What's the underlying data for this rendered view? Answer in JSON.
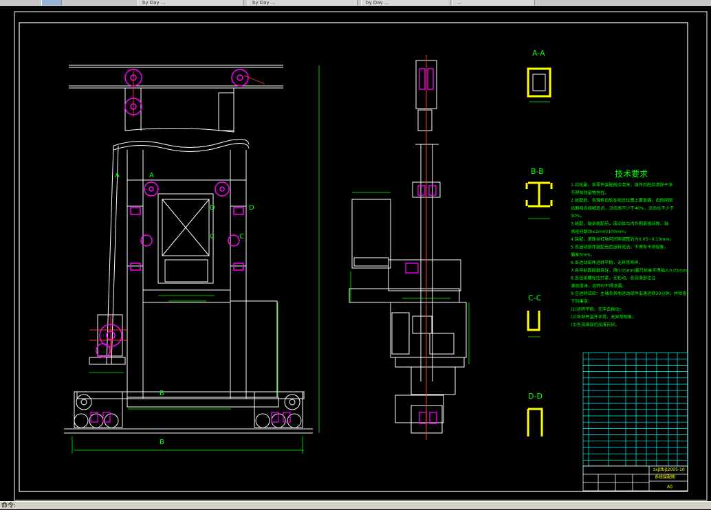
{
  "tabs": [
    {
      "label": ""
    },
    {
      "label": "by Day ..."
    },
    {
      "label": "by Day ..."
    },
    {
      "label": "by Day ..."
    },
    {
      "label": "..."
    }
  ],
  "sections": {
    "aa": "A-A",
    "bb": "B-B",
    "cc": "C-C",
    "dd": "D-D",
    "a_left": "A",
    "a_right": "A",
    "b_top": "B",
    "b_bottom": "B",
    "c_left": "C",
    "c_right": "C",
    "d_left": "D",
    "d_right": "D"
  },
  "tech": {
    "title": "技术要求",
    "lines": [
      "1.齿轮副、各零件装配前应清洗，铸件内腔应清除干净",
      "  不得有残留物存在。",
      "2.装配后，各滑移齿轮在啮合位置上要准确，齿侧间隙",
      "  齿面啮合接触斑点，沿齿高不少于40%，沿齿长不少于",
      "  50%。",
      "3.装配，轴承装配后，滚动体与内外圈滚道间隙，轴",
      "  承径向跳动≤2mm/100mm。",
      "4.装配，滚珠丝杠轴向间隙调整后为0.05~0.10mm。",
      "5.各运动部件装配后应运转灵活，不得有卡滞现象，",
      "  偏差5mm。",
      "6.各运动部件运转平稳，无异常响声。",
      "7.各导轨面接触良好，用0.05mm塞尺检查不得插入0.05mm。",
      "8.各连接螺栓应拧紧，无松动，各润滑部位注",
      "  满润滑油，运转时不得渗漏。",
      "9.空运转试验：主轴及其他运动部件低速运转30分钟，并检查",
      "  下列事项：",
      "  (1)运转平稳，无冲击振动；",
      "  (2)各部件温升正常，无异常现象；",
      "  (3)各润滑部位润滑良好。"
    ]
  },
  "title_block": {
    "drawing_no": "zxjtfbjt2005-10",
    "name": "系统装配图",
    "sheet": "A0"
  },
  "status": {
    "prompt": "命令:"
  },
  "colors": {
    "frame": "#ffffff",
    "pink": "#ff00ff",
    "green": "#00ff00",
    "yellow": "#ffff00",
    "red": "#ff3333",
    "cyan": "#00ffff"
  }
}
